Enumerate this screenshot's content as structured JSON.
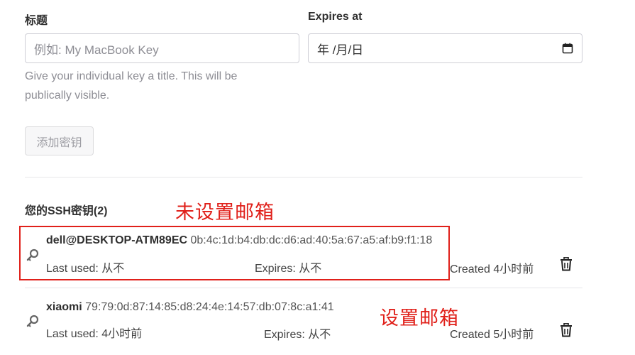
{
  "form": {
    "title_label": "标题",
    "title_placeholder": "例如: My MacBook Key",
    "title_help": "Give your individual key a title. This will be publically visible.",
    "expires_label": "Expires at",
    "expires_value": "年 /月/日",
    "add_button": "添加密钥"
  },
  "keys_section": {
    "title": "您的SSH密钥(2)"
  },
  "annotations": {
    "no_email": "未设置邮箱",
    "has_email": "设置邮箱"
  },
  "keys": [
    {
      "name": "dell@DESKTOP-ATM89EC",
      "fingerprint": "0b:4c:1d:b4:db:dc:d6:ad:40:5a:67:a5:af:b9:f1:18",
      "last_used": "Last used: 从不",
      "expires": "Expires: 从不",
      "created": "Created 4小时前"
    },
    {
      "name": "xiaomi",
      "fingerprint": "79:79:0d:87:14:85:d8:24:4e:14:57:db:07:8c:a1:41",
      "last_used": "Last used: 4小时前",
      "expires": "Expires: 从不",
      "created": "Created 5小时前"
    }
  ],
  "icons": {
    "key": "key-icon",
    "delete": "trash-icon",
    "calendar": "calendar-icon"
  },
  "colors": {
    "annotation": "#e0201a"
  }
}
